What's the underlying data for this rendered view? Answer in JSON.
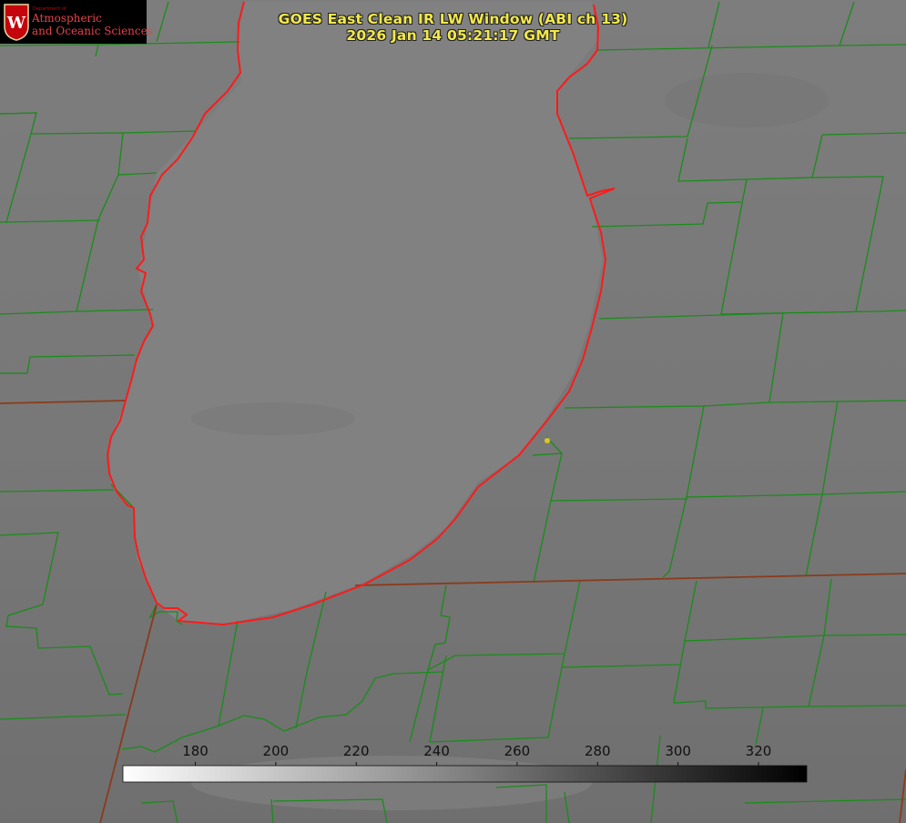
{
  "title": {
    "line1": "GOES East Clean IR LW Window (ABI ch 13)",
    "line2": "2026 Jan 14 05:21:17 GMT"
  },
  "logo": {
    "department": "Department of",
    "line1": "Atmospheric",
    "line2": "and Oceanic Sciences",
    "crest_letter": "W"
  },
  "colorbar": {
    "min_value": 162,
    "max_value": 332,
    "ticks": [
      180,
      200,
      220,
      240,
      260,
      280,
      300,
      320
    ],
    "tick_labels": [
      "180",
      "200",
      "220",
      "240",
      "260",
      "280",
      "300",
      "320"
    ],
    "gradient_from": "#ffffff",
    "gradient_to": "#000000"
  },
  "colors": {
    "background": "#7b7b7b",
    "lake": "#808080",
    "county_lines": "#1a8c1a",
    "state_lines": "#8b3a1a",
    "shoreline": "#ff1a1a",
    "title_text": "#f2e84a",
    "marker": "#d8c820"
  },
  "icons": {
    "logo_crest": "uw-madison-crest",
    "station_marker": "yellow-dot"
  }
}
